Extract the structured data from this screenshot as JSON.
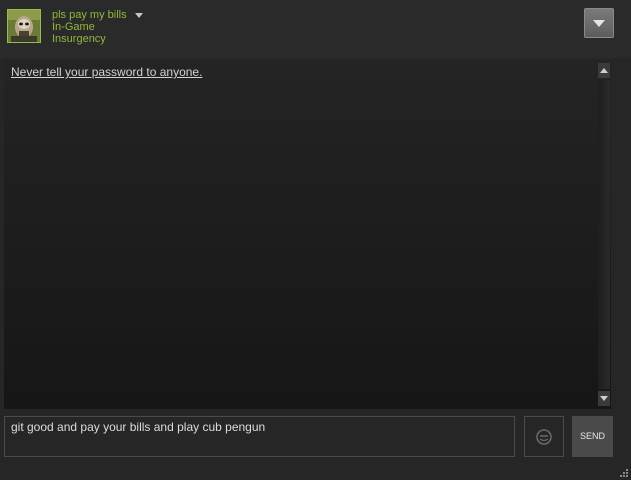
{
  "header": {
    "username": "pls pay my bills",
    "status": "In-Game",
    "game": "Insurgency"
  },
  "chat": {
    "notice": "Never tell your password to anyone."
  },
  "composer": {
    "message": "git good and pay your bills and play cub pengun",
    "send_label": "SEND"
  },
  "icons": {
    "avatar": "avatar-image",
    "menu": "chevron-down-icon",
    "emoticon": "emoticon-icon",
    "resize": "resize-grip-icon"
  },
  "colors": {
    "accent": "#8fb93b",
    "background": "#262626"
  }
}
